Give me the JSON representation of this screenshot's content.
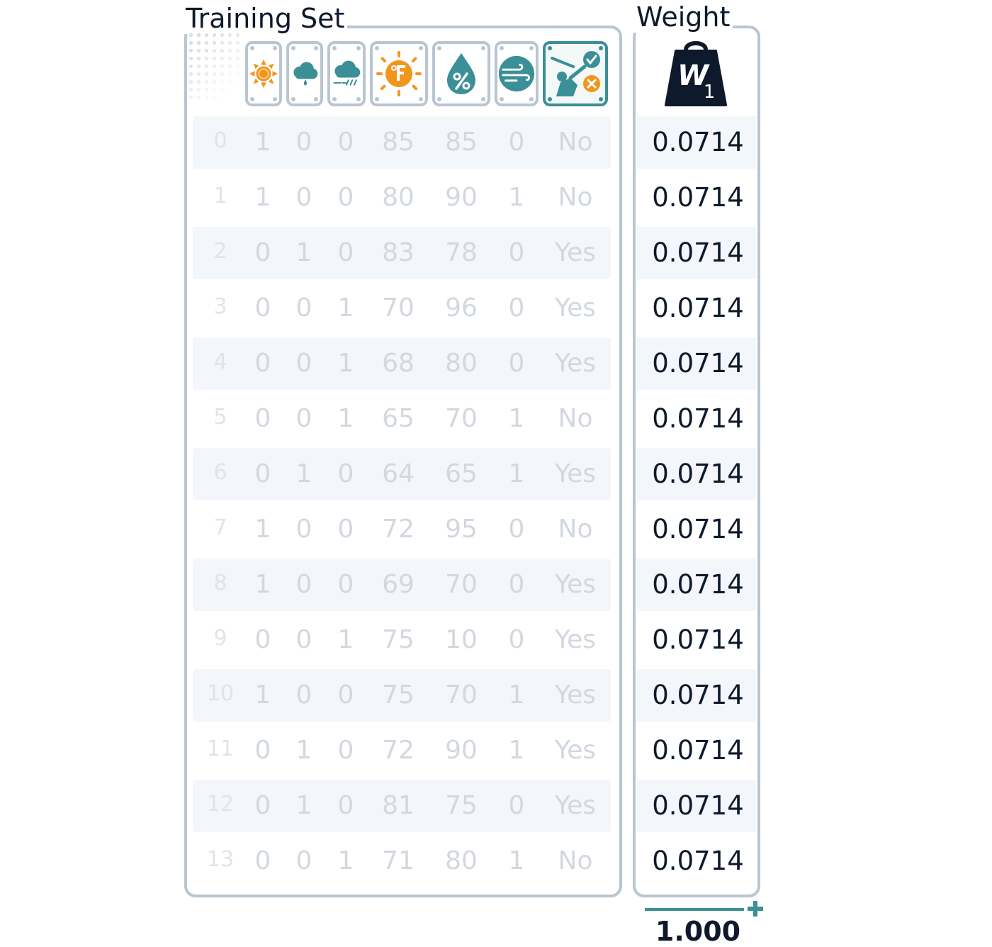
{
  "training_set": {
    "title": "Training Set",
    "columns": [
      {
        "icon": "sunny-icon",
        "color": "#f0961c"
      },
      {
        "icon": "rain-cloud-icon",
        "color": "#3b8f96"
      },
      {
        "icon": "windy-rain-cloud-icon",
        "color": "#3b8f96"
      },
      {
        "icon": "temperature-fahrenheit-icon",
        "color": "#f0961c"
      },
      {
        "icon": "humidity-percent-icon",
        "color": "#3b8f96"
      },
      {
        "icon": "wind-icon",
        "color": "#3b8f96"
      },
      {
        "icon": "play-golf-target-icon",
        "color": "#3b8f96"
      }
    ],
    "rows": [
      {
        "index": "0",
        "cells": [
          "1",
          "0",
          "0",
          "85",
          "85",
          "0",
          "No"
        ]
      },
      {
        "index": "1",
        "cells": [
          "1",
          "0",
          "0",
          "80",
          "90",
          "1",
          "No"
        ]
      },
      {
        "index": "2",
        "cells": [
          "0",
          "1",
          "0",
          "83",
          "78",
          "0",
          "Yes"
        ]
      },
      {
        "index": "3",
        "cells": [
          "0",
          "0",
          "1",
          "70",
          "96",
          "0",
          "Yes"
        ]
      },
      {
        "index": "4",
        "cells": [
          "0",
          "0",
          "1",
          "68",
          "80",
          "0",
          "Yes"
        ]
      },
      {
        "index": "5",
        "cells": [
          "0",
          "0",
          "1",
          "65",
          "70",
          "1",
          "No"
        ]
      },
      {
        "index": "6",
        "cells": [
          "0",
          "1",
          "0",
          "64",
          "65",
          "1",
          "Yes"
        ]
      },
      {
        "index": "7",
        "cells": [
          "1",
          "0",
          "0",
          "72",
          "95",
          "0",
          "No"
        ]
      },
      {
        "index": "8",
        "cells": [
          "1",
          "0",
          "0",
          "69",
          "70",
          "0",
          "Yes"
        ]
      },
      {
        "index": "9",
        "cells": [
          "0",
          "0",
          "1",
          "75",
          "10",
          "0",
          "Yes"
        ]
      },
      {
        "index": "10",
        "cells": [
          "1",
          "0",
          "0",
          "75",
          "70",
          "1",
          "Yes"
        ]
      },
      {
        "index": "11",
        "cells": [
          "0",
          "1",
          "0",
          "72",
          "90",
          "1",
          "Yes"
        ]
      },
      {
        "index": "12",
        "cells": [
          "0",
          "1",
          "0",
          "81",
          "75",
          "0",
          "Yes"
        ]
      },
      {
        "index": "13",
        "cells": [
          "0",
          "0",
          "1",
          "71",
          "80",
          "1",
          "No"
        ]
      }
    ]
  },
  "weight": {
    "title": "Weight",
    "icon": "weight-w1-icon",
    "icon_text": "W",
    "icon_subscript": "1",
    "values": [
      "0.0714",
      "0.0714",
      "0.0714",
      "0.0714",
      "0.0714",
      "0.0714",
      "0.0714",
      "0.0714",
      "0.0714",
      "0.0714",
      "0.0714",
      "0.0714",
      "0.0714",
      "0.0714"
    ],
    "sum": "1.000",
    "sum_icon": "plus-icon"
  },
  "colors": {
    "border": "#b9c5d2",
    "teal": "#3b8f96",
    "orange": "#f0961c",
    "dark": "#0e1a2b",
    "faded_text": "#d3d8df"
  }
}
